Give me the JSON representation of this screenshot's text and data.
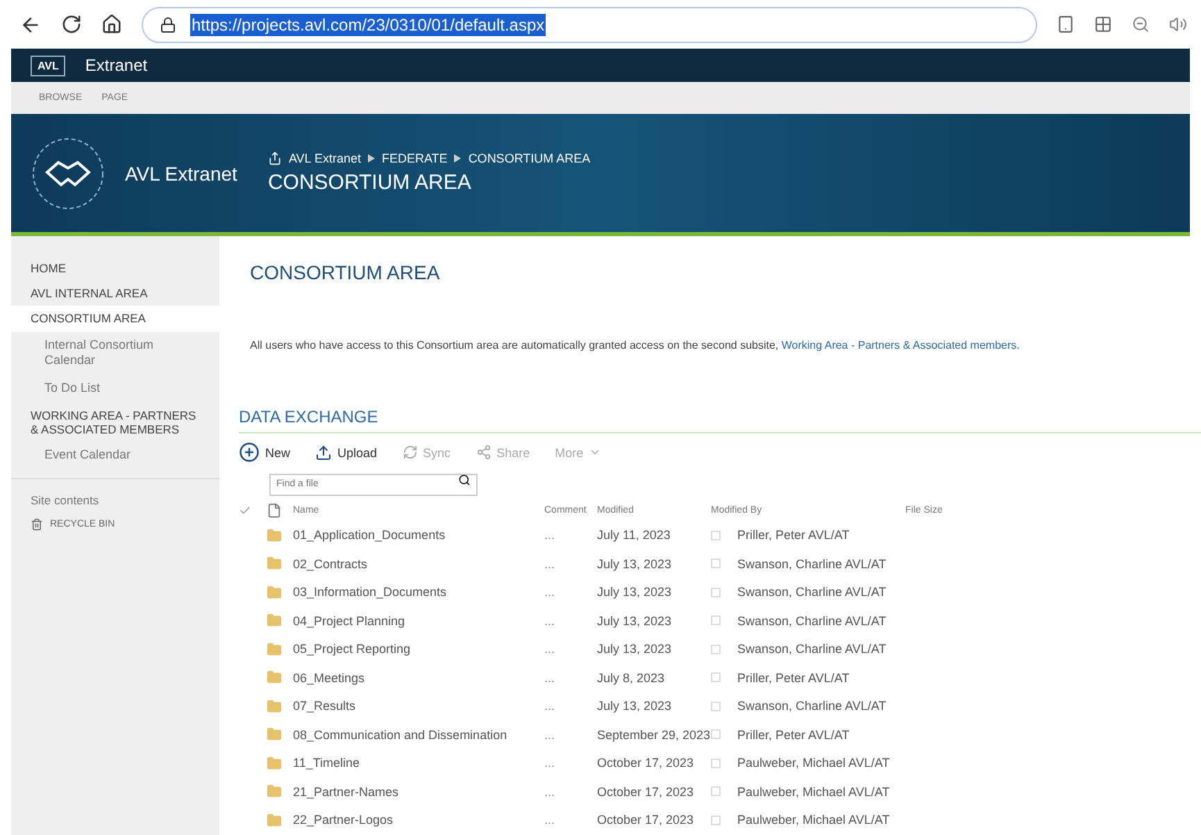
{
  "browser": {
    "address": {
      "value": "https://projects.avl.com/23/0310/01/default.aspx",
      "selected": true
    }
  },
  "suite_bar": {
    "logo": "AVL",
    "title": "Extranet"
  },
  "ribbon": {
    "tabs": [
      {
        "label": "BROWSE",
        "selected": false
      },
      {
        "label": "PAGE",
        "selected": false
      }
    ]
  },
  "header": {
    "site_title": "AVL Extranet",
    "breadcrumb": [
      "AVL Extranet",
      "FEDERATE",
      "CONSORTIUM AREA"
    ],
    "page_title": "CONSORTIUM AREA"
  },
  "sidebar": {
    "items": [
      {
        "label": "HOME",
        "selected": false
      },
      {
        "label": "AVL INTERNAL AREA",
        "selected": false
      },
      {
        "label": "CONSORTIUM AREA",
        "selected": true,
        "children": [
          {
            "label": "Internal Consortium Calendar",
            "selected": false
          },
          {
            "label": "To Do List",
            "selected": false
          }
        ]
      },
      {
        "label": "WORKING AREA - PARTNERS & ASSOCIATED MEMBERS",
        "selected": false,
        "children": [
          {
            "label": "Event Calendar",
            "selected": false
          }
        ]
      }
    ],
    "site_contents": "Site contents",
    "recycle_bin": "RECYCLE BIN"
  },
  "content": {
    "title": "CONSORTIUM AREA",
    "intro": "All users who have access to this Consortium area are automatically granted access on the second subsite, ",
    "intro_link": "Working Area - Partners & Associated members",
    "intro_end": ".",
    "section_title": "DATA EXCHANGE",
    "toolbar": [
      {
        "label": "New",
        "kind": "new",
        "disabled": false
      },
      {
        "label": "Upload",
        "kind": "upload",
        "disabled": false
      },
      {
        "label": "Sync",
        "kind": "sync",
        "disabled": true
      },
      {
        "label": "Share",
        "kind": "share",
        "disabled": true
      },
      {
        "label": "More",
        "kind": "more",
        "disabled": true
      }
    ],
    "search": {
      "placeholder": "Find a file"
    },
    "table": {
      "columns": [
        "Name",
        "Comment",
        "Modified",
        "Modified By",
        "File Size"
      ],
      "rows": [
        {
          "name": "01_Application_Documents",
          "menu": "...",
          "modified": "July 11, 2023",
          "modified_by": "Priller, Peter AVL/AT"
        },
        {
          "name": "02_Contracts",
          "menu": "...",
          "modified": "July 13, 2023",
          "modified_by": "Swanson, Charline AVL/AT"
        },
        {
          "name": "03_Information_Documents",
          "menu": "...",
          "modified": "July 13, 2023",
          "modified_by": "Swanson, Charline AVL/AT"
        },
        {
          "name": "04_Project Planning",
          "menu": "...",
          "modified": "July 13, 2023",
          "modified_by": "Swanson, Charline AVL/AT"
        },
        {
          "name": "05_Project Reporting",
          "menu": "...",
          "modified": "July 13, 2023",
          "modified_by": "Swanson, Charline AVL/AT"
        },
        {
          "name": "06_Meetings",
          "menu": "...",
          "modified": "July 8, 2023",
          "modified_by": "Priller, Peter AVL/AT"
        },
        {
          "name": "07_Results",
          "menu": "...",
          "modified": "July 13, 2023",
          "modified_by": "Swanson, Charline AVL/AT"
        },
        {
          "name": "08_Communication and Dissemination",
          "menu": "...",
          "modified": "September 29, 2023",
          "modified_by": "Priller, Peter AVL/AT"
        },
        {
          "name": "11_Timeline",
          "menu": "...",
          "modified": "October 17, 2023",
          "modified_by": "Paulweber, Michael AVL/AT"
        },
        {
          "name": "21_Partner-Names",
          "menu": "...",
          "modified": "October 17, 2023",
          "modified_by": "Paulweber, Michael AVL/AT"
        },
        {
          "name": "22_Partner-Logos",
          "menu": "...",
          "modified": "October 17, 2023",
          "modified_by": "Paulweber, Michael AVL/AT"
        }
      ]
    }
  }
}
